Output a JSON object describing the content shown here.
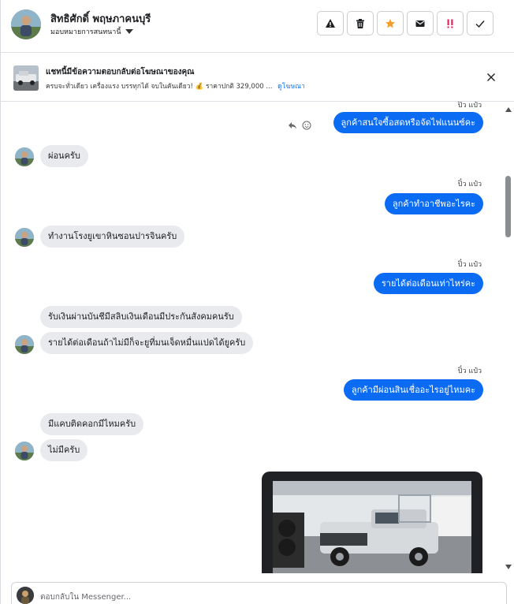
{
  "header": {
    "name": "สิทธิศักดิ์ พฤษภาคนบุรี",
    "assign_label": "มอบหมายการสนทนานี้",
    "actions": [
      "spam-alert",
      "delete",
      "star",
      "mark-unread",
      "mark-important",
      "done"
    ]
  },
  "ad": {
    "title": "แชทนี้มีข้อความตอบกลับต่อโฆษณาของคุณ",
    "subtitle": "ครบจะทั่วเดียว เครื่องแรง บรรทุกได้ จบในคันเดียว! 💰 ราคาปกติ 329,000 ...",
    "link": "ดูโฆษณา"
  },
  "messages": [
    {
      "dir": "out",
      "text": "ลูกค้าสนใจซื้อสดหรือจัดไฟแนนซ์คะ",
      "seen": "ปิ๋ว แป๋ว"
    },
    {
      "dir": "in",
      "text": "ผ่อนครับ"
    },
    {
      "dir": "out",
      "text": "ลูกค้าทำอาชีพอะไรคะ",
      "seen": "ปิ๋ว แป๋ว"
    },
    {
      "dir": "in",
      "text": "ทำงานโรงยูเขาหินซอนปารจินครับ"
    },
    {
      "dir": "out",
      "text": "รายได้ต่อเดือนเท่าไหร่คะ",
      "seen": "ปิ๋ว แป๋ว"
    },
    {
      "dir": "in",
      "text": "รับเงินผ่านบันชีมีสลิบเงินเดือนมีประกันสังคมคนรับ"
    },
    {
      "dir": "in",
      "text": "รายได้ต่อเดือนถ้าไม่มีก็จะยูที่มนเจ็ดหมื่นแปดได้ยูครับ"
    },
    {
      "dir": "out",
      "text": "ลูกค้ามีผ่อนสินเชื่ออะไรอยู่ไหมคะ",
      "seen": "ปิ๋ว แป๋ว"
    },
    {
      "dir": "in",
      "text": "มีแคบติดคอกมีไหมครับ"
    },
    {
      "dir": "in",
      "text": "ไม่มีครับ"
    }
  ],
  "composer": {
    "placeholder": "ตอบกลับใน Messenger..."
  },
  "colors": {
    "outgoing_bubble": "#0b6bf2",
    "incoming_bubble": "#e9eaed",
    "link": "#1877f2",
    "star": "#f59e2a",
    "important": "#e0245e"
  }
}
